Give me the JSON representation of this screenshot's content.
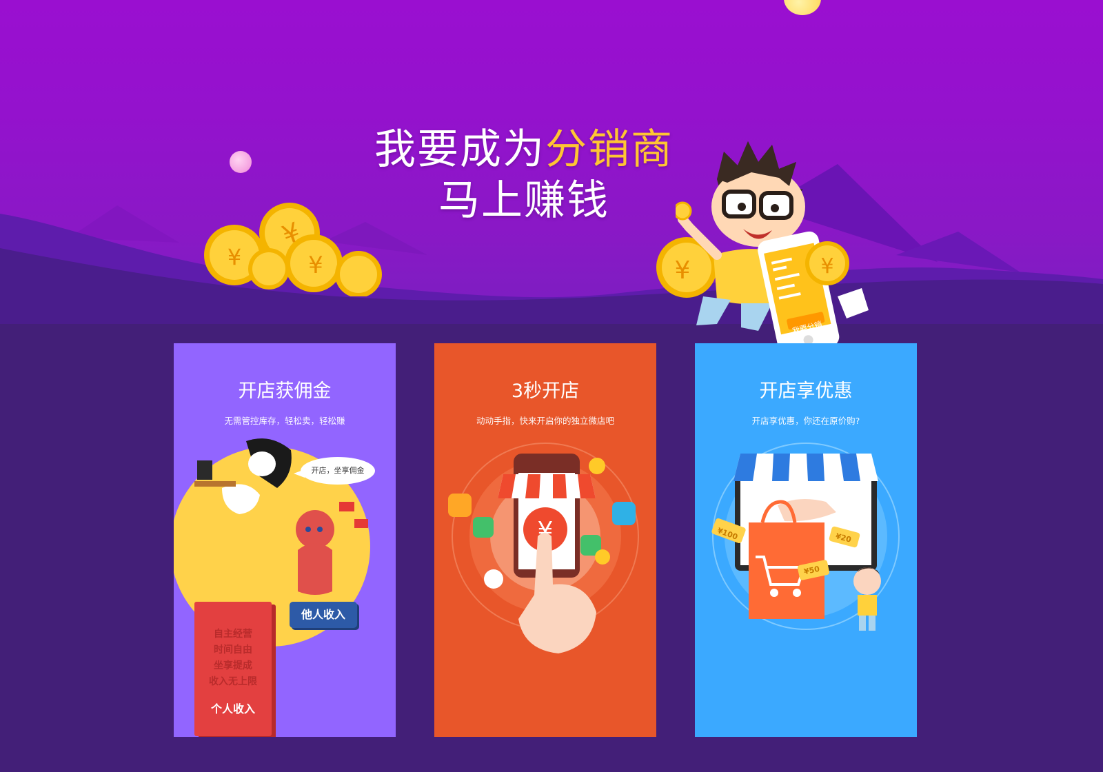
{
  "hero": {
    "title_prefix": "我要成为",
    "title_highlight": "分销商",
    "title_line2": "马上赚钱",
    "phone_label": "我要分销"
  },
  "cards": [
    {
      "title": "开店获佣金",
      "subtitle": "无需管控库存，轻松卖，轻松赚",
      "bubble": "开店，坐享佣金",
      "box_lines": [
        "自主经营",
        "时间自由",
        "坐享提成",
        "收入无上限"
      ],
      "box_main": "个人收入",
      "box_secondary": "他人收入",
      "color": "#9265ff"
    },
    {
      "title": "3秒开店",
      "subtitle": "动动手指，快来开启你的独立微店吧",
      "color": "#e8562a"
    },
    {
      "title": "开店享优惠",
      "subtitle": "开店享优惠，你还在原价购?",
      "coupons": [
        "¥100",
        "¥20",
        "¥50"
      ],
      "color": "#3ba9ff"
    }
  ],
  "colors": {
    "hero_purple": "#9a0fd0",
    "page_bg": "#431f78",
    "highlight_gold": "#ffc533"
  }
}
